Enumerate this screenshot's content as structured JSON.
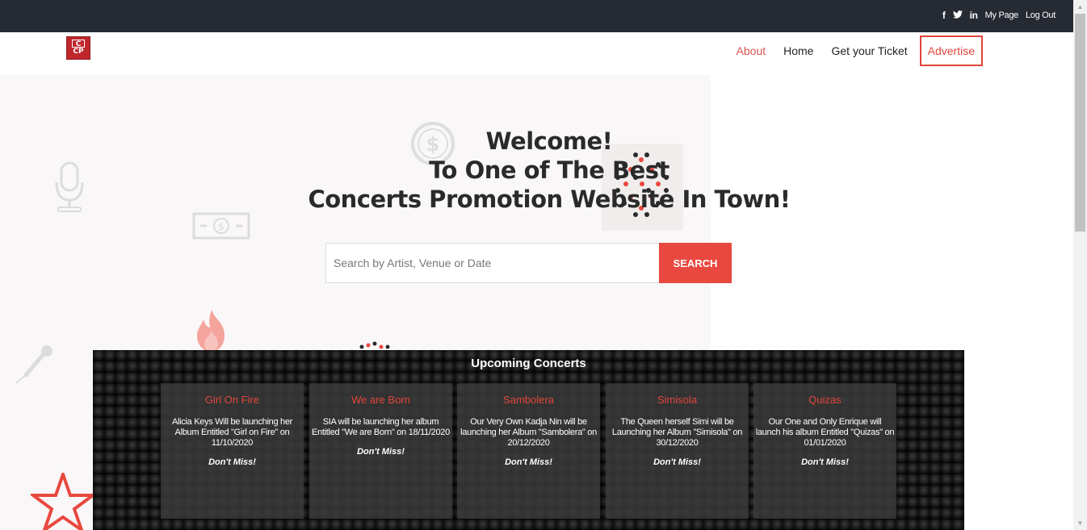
{
  "topbar": {
    "social": [
      "f",
      "t",
      "in"
    ],
    "my_page": "My Page",
    "log_out": "Log Out"
  },
  "header": {
    "logo_top": "C",
    "logo_bottom": "CP",
    "nav": {
      "about": "About",
      "home": "Home",
      "ticket": "Get your Ticket",
      "advertise": "Advertise"
    }
  },
  "hero": {
    "line1": "Welcome!",
    "line2": "To One of The Best",
    "line3": "Concerts Promotion Website In Town!"
  },
  "search": {
    "placeholder": "Search by Artist, Venue or Date",
    "button": "SEARCH"
  },
  "concerts": {
    "title": "Upcoming Concerts",
    "items": [
      {
        "name": "Girl On Fire",
        "desc": "Alicia Keys Will be launching her Album Entitled \"Girl on Fire\" on 11/10/2020",
        "tag": "Don't Miss!"
      },
      {
        "name": "We are Born",
        "desc": "SIA will be launching her album Entitled \"We are Born\" on 18/11/2020",
        "tag": "Don't Miss!"
      },
      {
        "name": "Sambolera",
        "desc": "Our Very Own Kadja Nin will be launching her Album \"Sambolera\" on 20/12/2020",
        "tag": "Don't Miss!"
      },
      {
        "name": "Simisola",
        "desc": "The Queen herself Simi will be Launching her Album \"Simisola\" on 30/12/2020",
        "tag": "Don't Miss!"
      },
      {
        "name": "Quizas",
        "desc": "Our One and Only Enrique will launch his album Entitled \"Quizas\" on 01/01/2020",
        "tag": "Don't Miss!"
      }
    ]
  },
  "colors": {
    "accent": "#e0453b",
    "topbar": "#262a33",
    "hero_bg": "#faf7f8"
  },
  "icons": [
    "facebook-icon",
    "twitter-icon",
    "linkedin-icon",
    "dollar-coin-icon",
    "microphone-icon",
    "banknote-icon",
    "flame-icon",
    "handheld-mic-icon",
    "star-icon",
    "dot-pattern-icon"
  ]
}
